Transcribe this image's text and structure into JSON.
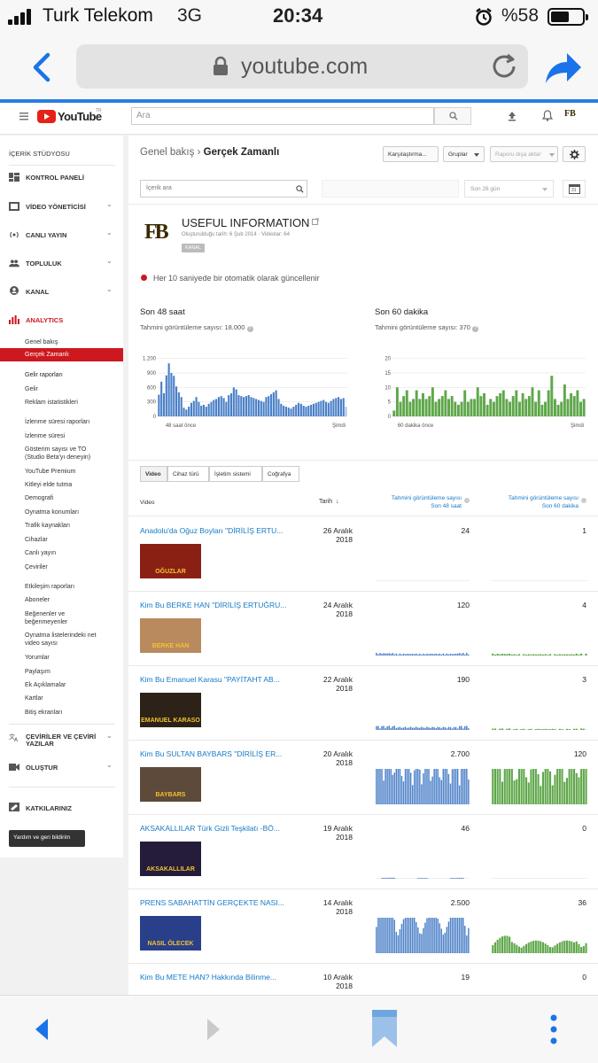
{
  "status_bar": {
    "carrier": "Turk Telekom",
    "network": "3G",
    "time": "20:34",
    "battery_percent": "%58",
    "battery_level": 0.58
  },
  "browser": {
    "url": "youtube.com"
  },
  "yt_header": {
    "logo_text": "YouTube",
    "logo_sup": "TR",
    "search_placeholder": "Ara"
  },
  "sidebar": {
    "title": "İÇERİK STÜDYOSU",
    "sections": [
      {
        "label": "KONTROL PANELİ"
      },
      {
        "label": "VİDEO YÖNETİCİSİ"
      },
      {
        "label": "CANLI YAYIN"
      },
      {
        "label": "TOPLULUK"
      },
      {
        "label": "KANAL"
      },
      {
        "label": "ANALYTICS"
      }
    ],
    "analytics_items": [
      "Genel bakış",
      "Gerçek Zamanlı",
      "Gelir raporları",
      "Gelir",
      "Reklam istatistikleri",
      "İzlenme süresi raporları",
      "İzlenme süresi",
      "Gösterim sayısı ve TO",
      "(Studio Beta'yı deneyin)",
      "YouTube Premium",
      "Kitleyi elde tutma",
      "Demografi",
      "Oynatma konumları",
      "Trafik kaynakları",
      "Cihazlar",
      "Canlı yayın",
      "Çeviriler",
      "Etkileşim raporları",
      "Aboneler",
      "Beğenenler ve",
      "beğenmeyenler",
      "Oynatma listelerindeki net",
      "video sayısı",
      "Yorumlar",
      "Paylaşım",
      "Ek Açıklamalar",
      "Kartlar",
      "Bitiş ekranları"
    ],
    "bottom_sections": [
      {
        "label": "ÇEVİRİLER VE ÇEVİRİ"
      },
      {
        "label": "YAZILAR"
      },
      {
        "label": "OLUŞTUR"
      },
      {
        "label": "KATKILARINIZ"
      }
    ],
    "feedback_label": "Yardım ve geri bildirim"
  },
  "main": {
    "breadcrumb_parent": "Genel bakış",
    "breadcrumb_sep": "›",
    "breadcrumb_current": "Gerçek Zamanlı",
    "compare_button": "Karşılaştırma...",
    "groups_button": "Gruplar",
    "export_button": "Raporu dışa aktar",
    "content_search_placeholder": "İçerik ara",
    "date_range": "Son 28 gün",
    "calendar_day": "31",
    "channel": {
      "name": "USEFUL INFORMATION",
      "meta": "Oluşturulduğu tarih: 6 Şub 2014 · Videolar: 64",
      "badge": "KANAL",
      "logo": "FB"
    },
    "update_notice": "Her 10 saniyede bir otomatik olarak güncellenir",
    "panel48": {
      "title": "Son 48 saat",
      "subtitle": "Tahmini görüntüleme sayısı: 18.000"
    },
    "panel60": {
      "title": "Son 60 dakika",
      "subtitle": "Tahmini görüntüleme sayısı: 370"
    },
    "tabs": [
      "Video",
      "Cihaz türü",
      "İşletim sistemi",
      "Coğrafya"
    ],
    "table_head": {
      "video": "Video",
      "date": "Tarih",
      "col48_a": "Tahmini görüntüleme sayısı",
      "col48_b": "Son 48 saat",
      "col60_a": "Tahmini görüntüleme sayısı",
      "col60_b": "Son 60 dakika"
    },
    "rows": [
      {
        "title": "Anadolu'da Oğuz Boyları \"DİRİLİŞ ERTU...",
        "date": "26 Aralık 2018",
        "views48": "24",
        "views60": "1",
        "thumb_text": "OĞUZLAR",
        "bg": "#8a1f14"
      },
      {
        "title": "Kim Bu BERKE HAN \"DİRİLİŞ ERTUĞRU...",
        "date": "24 Aralık 2018",
        "views48": "120",
        "views60": "4",
        "thumb_text": "BERKE HAN",
        "bg": "#b98a5e"
      },
      {
        "title": "Kim Bu Emanuel Karasu \"PAYİTAHT AB...",
        "date": "22 Aralık 2018",
        "views48": "190",
        "views60": "3",
        "thumb_text": "EMANUEL KARASO",
        "bg": "#2c2218"
      },
      {
        "title": "Kim Bu SULTAN BAYBARS \"DİRİLİŞ ER...",
        "date": "20 Aralık 2018",
        "views48": "2.700",
        "views60": "120",
        "thumb_text": "BAYBARS",
        "bg": "#5d4a3a"
      },
      {
        "title": "AKSAKALLILAR Türk Gizli Teşkilatı -BÖ...",
        "date": "19 Aralık 2018",
        "views48": "46",
        "views60": "0",
        "thumb_text": "AKSAKALLILAR",
        "bg": "#241c3a"
      },
      {
        "title": "PRENS SABAHATTİN GERÇEKTE NASI...",
        "date": "14 Aralık 2018",
        "views48": "2.500",
        "views60": "36",
        "thumb_text": "NASIL ÖLECEK",
        "bg": "#2a3f8a"
      },
      {
        "title": "Kim Bu METE HAN? Hakkında Bilinme...",
        "date": "10 Aralık 2018",
        "views48": "19",
        "views60": "0",
        "thumb_text": "",
        "bg": "#444"
      }
    ]
  },
  "chart_data": [
    {
      "type": "bar",
      "title": "Son 48 saat",
      "ylabel": "",
      "xlabel": "",
      "x_labels": [
        "48 saat önce",
        "Şimdi"
      ],
      "yticks": [
        0,
        300,
        600,
        900,
        1200
      ],
      "ylim": [
        0,
        1250
      ],
      "grid": true,
      "color": "#4a7fc7",
      "values": [
        450,
        720,
        480,
        850,
        1100,
        900,
        840,
        620,
        500,
        400,
        180,
        140,
        200,
        280,
        320,
        400,
        300,
        220,
        240,
        200,
        260,
        300,
        340,
        360,
        400,
        420,
        380,
        300,
        440,
        480,
        600,
        560,
        440,
        420,
        400,
        420,
        440,
        400,
        380,
        360,
        340,
        320,
        300,
        400,
        420,
        460,
        500,
        540,
        360,
        260,
        220,
        200,
        180,
        160,
        200,
        240,
        280,
        260,
        220,
        200,
        220,
        240,
        260,
        280,
        300,
        320,
        340,
        300,
        280,
        320,
        360,
        380,
        400,
        360,
        380,
        200
      ]
    },
    {
      "type": "bar",
      "title": "Son 60 dakika",
      "ylabel": "",
      "xlabel": "",
      "x_labels": [
        "60 dakika önce",
        "Şimdi"
      ],
      "yticks": [
        0,
        5,
        10,
        15,
        20
      ],
      "ylim": [
        0,
        20.8
      ],
      "grid": true,
      "color": "#5fa74a",
      "values": [
        2,
        10,
        5,
        7,
        9,
        5,
        6,
        9,
        6,
        8,
        6,
        7,
        10,
        5,
        6,
        7,
        9,
        6,
        7,
        5,
        4,
        5,
        9,
        5,
        6,
        6,
        10,
        7,
        8,
        4,
        6,
        5,
        7,
        8,
        9,
        6,
        5,
        7,
        9,
        5,
        8,
        6,
        7,
        10,
        5,
        9,
        4,
        5,
        9,
        14,
        6,
        4,
        5,
        11,
        6,
        8,
        7,
        9,
        5,
        6
      ]
    }
  ]
}
